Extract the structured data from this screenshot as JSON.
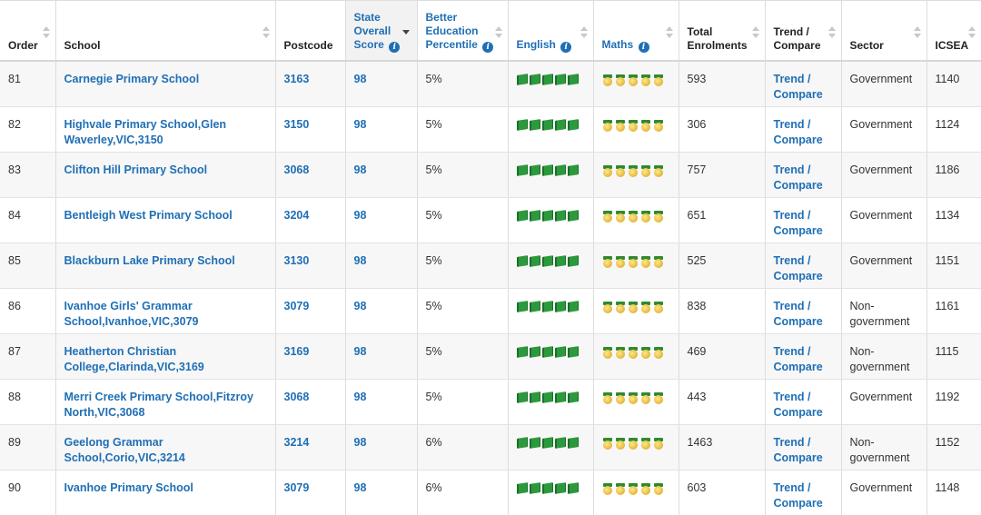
{
  "columns": {
    "order": "Order",
    "school": "School",
    "postcode": "Postcode",
    "state_score_l1": "State",
    "state_score_l2": "Overall",
    "state_score_l3": "Score",
    "percentile_l1": "Better",
    "percentile_l2": "Education",
    "percentile_l3": "Percentile",
    "english": "English",
    "maths": "Maths",
    "enrol_l1": "Total",
    "enrol_l2": "Enrolments",
    "trend_l1": "Trend /",
    "trend_l2": "Compare",
    "sector": "Sector",
    "icsea": "ICSEA"
  },
  "sort": {
    "column": "state_overall_score",
    "direction": "descending"
  },
  "icons": {
    "english": "green-book-icon",
    "maths": "gold-medal-icon",
    "info": "info-icon"
  },
  "colors": {
    "link": "#1f6fb5",
    "row_alt": "#f7f7f7",
    "book_green": "#2c9a3c",
    "medal_gold": "#e2b53a"
  },
  "rows": [
    {
      "order": "81",
      "school_l1": "Carnegie Primary School",
      "school_l2": "",
      "postcode": "3163",
      "score": "98",
      "percentile": "5%",
      "english_rating": 5,
      "maths_rating": 5,
      "enrolments": "593",
      "trend_l1": "Trend /",
      "trend_l2": "Compare",
      "sector_l1": "Government",
      "sector_l2": "",
      "icsea": "1140"
    },
    {
      "order": "82",
      "school_l1": "Highvale Primary School,Glen",
      "school_l2": "Waverley,VIC,3150",
      "postcode": "3150",
      "score": "98",
      "percentile": "5%",
      "english_rating": 5,
      "maths_rating": 5,
      "enrolments": "306",
      "trend_l1": "Trend /",
      "trend_l2": "Compare",
      "sector_l1": "Government",
      "sector_l2": "",
      "icsea": "1124"
    },
    {
      "order": "83",
      "school_l1": "Clifton Hill Primary School",
      "school_l2": "",
      "postcode": "3068",
      "score": "98",
      "percentile": "5%",
      "english_rating": 5,
      "maths_rating": 5,
      "enrolments": "757",
      "trend_l1": "Trend /",
      "trend_l2": "Compare",
      "sector_l1": "Government",
      "sector_l2": "",
      "icsea": "1186"
    },
    {
      "order": "84",
      "school_l1": "Bentleigh West Primary School",
      "school_l2": "",
      "postcode": "3204",
      "score": "98",
      "percentile": "5%",
      "english_rating": 5,
      "maths_rating": 5,
      "enrolments": "651",
      "trend_l1": "Trend /",
      "trend_l2": "Compare",
      "sector_l1": "Government",
      "sector_l2": "",
      "icsea": "1134"
    },
    {
      "order": "85",
      "school_l1": "Blackburn Lake Primary School",
      "school_l2": "",
      "postcode": "3130",
      "score": "98",
      "percentile": "5%",
      "english_rating": 5,
      "maths_rating": 5,
      "enrolments": "525",
      "trend_l1": "Trend /",
      "trend_l2": "Compare",
      "sector_l1": "Government",
      "sector_l2": "",
      "icsea": "1151"
    },
    {
      "order": "86",
      "school_l1": "Ivanhoe Girls' Grammar",
      "school_l2": "School,Ivanhoe,VIC,3079",
      "postcode": "3079",
      "score": "98",
      "percentile": "5%",
      "english_rating": 5,
      "maths_rating": 5,
      "enrolments": "838",
      "trend_l1": "Trend /",
      "trend_l2": "Compare",
      "sector_l1": "Non-",
      "sector_l2": "government",
      "icsea": "1161"
    },
    {
      "order": "87",
      "school_l1": "Heatherton Christian",
      "school_l2": "College,Clarinda,VIC,3169",
      "postcode": "3169",
      "score": "98",
      "percentile": "5%",
      "english_rating": 5,
      "maths_rating": 5,
      "enrolments": "469",
      "trend_l1": "Trend /",
      "trend_l2": "Compare",
      "sector_l1": "Non-",
      "sector_l2": "government",
      "icsea": "1115"
    },
    {
      "order": "88",
      "school_l1": "Merri Creek Primary School,Fitzroy",
      "school_l2": "North,VIC,3068",
      "postcode": "3068",
      "score": "98",
      "percentile": "5%",
      "english_rating": 5,
      "maths_rating": 5,
      "enrolments": "443",
      "trend_l1": "Trend /",
      "trend_l2": "Compare",
      "sector_l1": "Government",
      "sector_l2": "",
      "icsea": "1192"
    },
    {
      "order": "89",
      "school_l1": "Geelong Grammar",
      "school_l2": "School,Corio,VIC,3214",
      "postcode": "3214",
      "score": "98",
      "percentile": "6%",
      "english_rating": 5,
      "maths_rating": 5,
      "enrolments": "1463",
      "trend_l1": "Trend /",
      "trend_l2": "Compare",
      "sector_l1": "Non-",
      "sector_l2": "government",
      "icsea": "1152"
    },
    {
      "order": "90",
      "school_l1": "Ivanhoe Primary School",
      "school_l2": "",
      "postcode": "3079",
      "score": "98",
      "percentile": "6%",
      "english_rating": 5,
      "maths_rating": 5,
      "enrolments": "603",
      "trend_l1": "Trend /",
      "trend_l2": "Compare",
      "sector_l1": "Government",
      "sector_l2": "",
      "icsea": "1148"
    }
  ]
}
